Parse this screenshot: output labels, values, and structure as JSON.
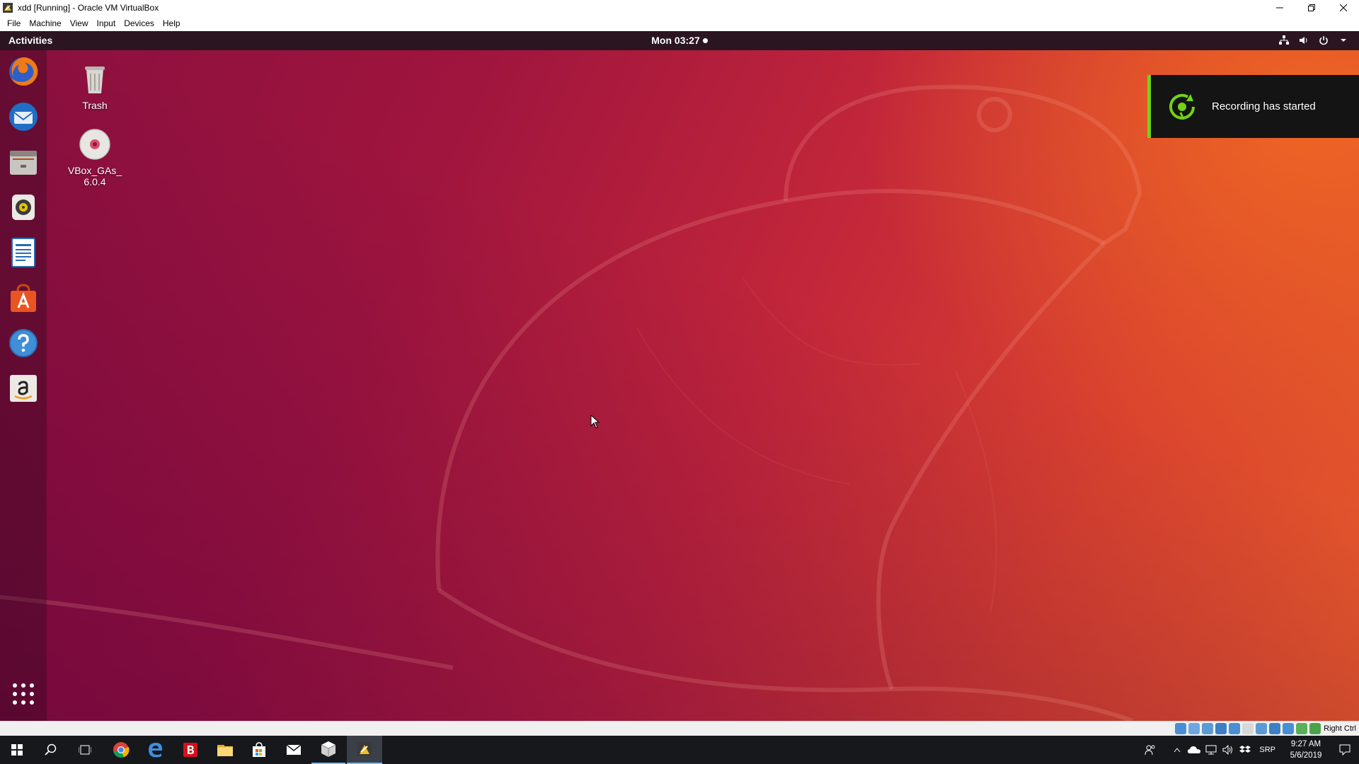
{
  "window": {
    "title": "xdd [Running] - Oracle VM VirtualBox",
    "menu": [
      "File",
      "Machine",
      "View",
      "Input",
      "Devices",
      "Help"
    ]
  },
  "guest": {
    "topbar": {
      "activities": "Activities",
      "clock": "Mon 03:27"
    },
    "dock": [
      "firefox-icon",
      "thunderbird-icon",
      "files-icon",
      "rhythmbox-icon",
      "libreoffice-writer-icon",
      "software-center-icon",
      "help-icon",
      "amazon-icon",
      "show-apps-icon"
    ],
    "desktop_icons": [
      {
        "label": "Trash",
        "icon": "trash-icon"
      },
      {
        "label": "VBox_GAs_\n6.0.4",
        "label_line1": "VBox_GAs_",
        "label_line2": "6.0.4",
        "icon": "optical-disc-icon"
      }
    ],
    "notification": {
      "text": "Recording has started",
      "accent": "#73d216"
    }
  },
  "statusbar": {
    "host_key": "Right Ctrl"
  },
  "taskbar": {
    "apps": [
      "start-icon",
      "search-icon",
      "task-view-icon",
      "chrome-icon",
      "edge-icon",
      "bitdefender-icon",
      "file-explorer-icon",
      "store-icon",
      "mail-icon",
      "virtualbox-icon",
      "virtualbox-vm-icon"
    ],
    "language": "SRP",
    "time": "9:27 AM",
    "date": "5/6/2019"
  },
  "colors": {
    "ubuntu_orange": "#e95420",
    "ubuntu_aubergine": "#77216f",
    "topbar": "#2b1520"
  }
}
